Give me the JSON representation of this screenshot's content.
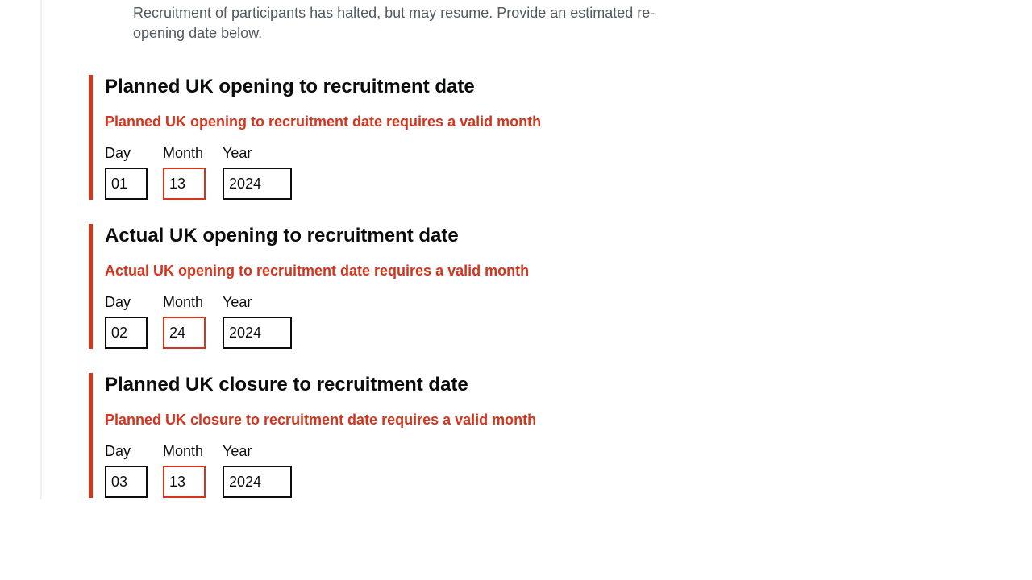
{
  "hint": "Recruitment of participants has halted, but may resume. Provide an estimated re-opening date below.",
  "colors": {
    "error": "#d4351c",
    "text": "#0b0c0c",
    "hint": "#505a5f"
  },
  "date_groups": [
    {
      "legend": "Planned UK opening to recruitment date",
      "error": "Planned UK opening to recruitment date requires a valid month",
      "day_label": "Day",
      "month_label": "Month",
      "year_label": "Year",
      "day": "01",
      "month": "13",
      "year": "2024"
    },
    {
      "legend": "Actual UK opening to recruitment date",
      "error": "Actual UK opening to recruitment date requires a valid month",
      "day_label": "Day",
      "month_label": "Month",
      "year_label": "Year",
      "day": "02",
      "month": "24",
      "year": "2024"
    },
    {
      "legend": "Planned UK closure to recruitment date",
      "error": "Planned UK closure to recruitment date requires a valid month",
      "day_label": "Day",
      "month_label": "Month",
      "year_label": "Year",
      "day": "03",
      "month": "13",
      "year": "2024"
    }
  ]
}
